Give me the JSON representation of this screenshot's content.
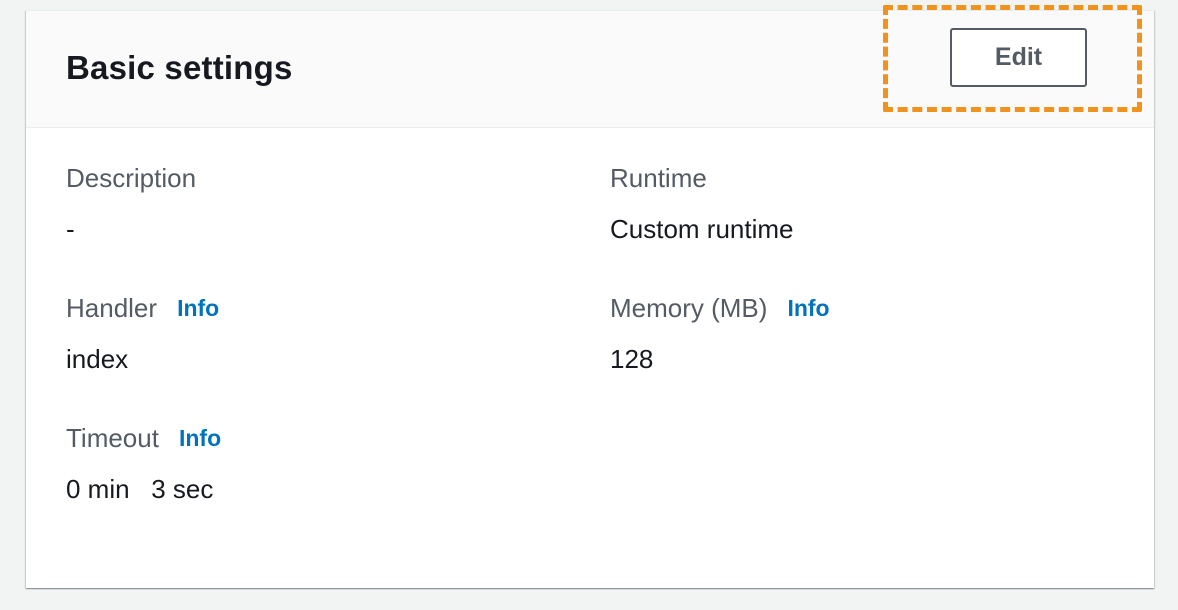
{
  "panel": {
    "title": "Basic settings",
    "edit_label": "Edit"
  },
  "fields": {
    "description": {
      "label": "Description",
      "value": "-"
    },
    "runtime": {
      "label": "Runtime",
      "value": "Custom runtime"
    },
    "handler": {
      "label": "Handler",
      "info": "Info",
      "value": "index"
    },
    "memory": {
      "label": "Memory (MB)",
      "info": "Info",
      "value": "128"
    },
    "timeout": {
      "label": "Timeout",
      "info": "Info",
      "value": "0 min   3 sec"
    }
  },
  "colors": {
    "highlight": "#f0921e",
    "link": "#0073bb",
    "label": "#545b64"
  }
}
